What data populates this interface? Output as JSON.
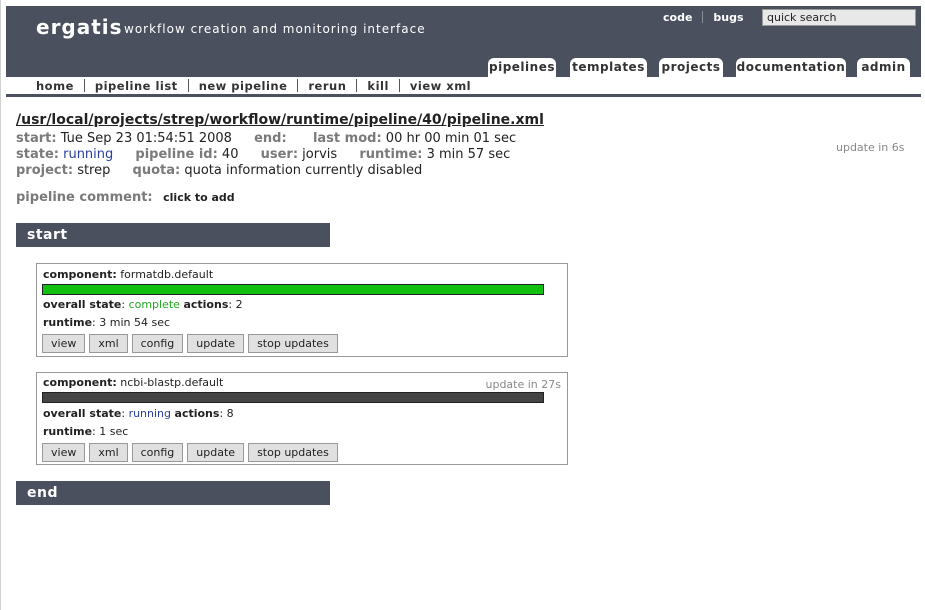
{
  "header": {
    "logo": "ergatis",
    "tagline": "workflow creation and monitoring interface",
    "links": [
      "code",
      "bugs"
    ],
    "search_value": "quick search"
  },
  "tabs": [
    "pipelines",
    "templates",
    "projects",
    "documentation",
    "admin"
  ],
  "subnav": [
    "home",
    "pipeline list",
    "new pipeline",
    "rerun",
    "kill",
    "view xml"
  ],
  "pipeline": {
    "path": "/usr/local/projects/strep/workflow/runtime/pipeline/40/pipeline.xml",
    "start_label": "start:",
    "start": "Tue Sep 23 01:54:51 2008",
    "end_label": "end:",
    "end": "",
    "lastmod_label": "last mod:",
    "lastmod": "00 hr 00 min 01 sec",
    "state_label": "state:",
    "state": "running",
    "id_label": "pipeline id:",
    "id": "40",
    "user_label": "user:",
    "user": "jorvis",
    "runtime_label": "runtime:",
    "runtime": "3 min 57 sec",
    "project_label": "project:",
    "project": "strep",
    "quota_label": "quota:",
    "quota": "quota information currently disabled",
    "update_in": "update in 6s",
    "comment_label": "pipeline comment:",
    "comment_action": "click to add"
  },
  "sections": {
    "start": "start",
    "end": "end"
  },
  "components": [
    {
      "component_label": "component:",
      "name": "formatdb.default",
      "state_label": "overall state",
      "state": "complete",
      "actions_label": "actions",
      "actions": "2",
      "runtime_label": "runtime",
      "runtime": "3 min 54 sec",
      "progress": 1.0,
      "bar_color": "#11c011",
      "update_in": ""
    },
    {
      "component_label": "component:",
      "name": "ncbi-blastp.default",
      "state_label": "overall state",
      "state": "running",
      "actions_label": "actions",
      "actions": "8",
      "runtime_label": "runtime",
      "runtime": "1 sec",
      "progress": 1.0,
      "bar_color": "#444444",
      "update_in": "update in 27s"
    }
  ],
  "buttons": [
    "view",
    "xml",
    "config",
    "update",
    "stop updates"
  ],
  "colors": {
    "header": "#4a505e",
    "running": "#2a3ea0",
    "complete": "#22aa22"
  }
}
